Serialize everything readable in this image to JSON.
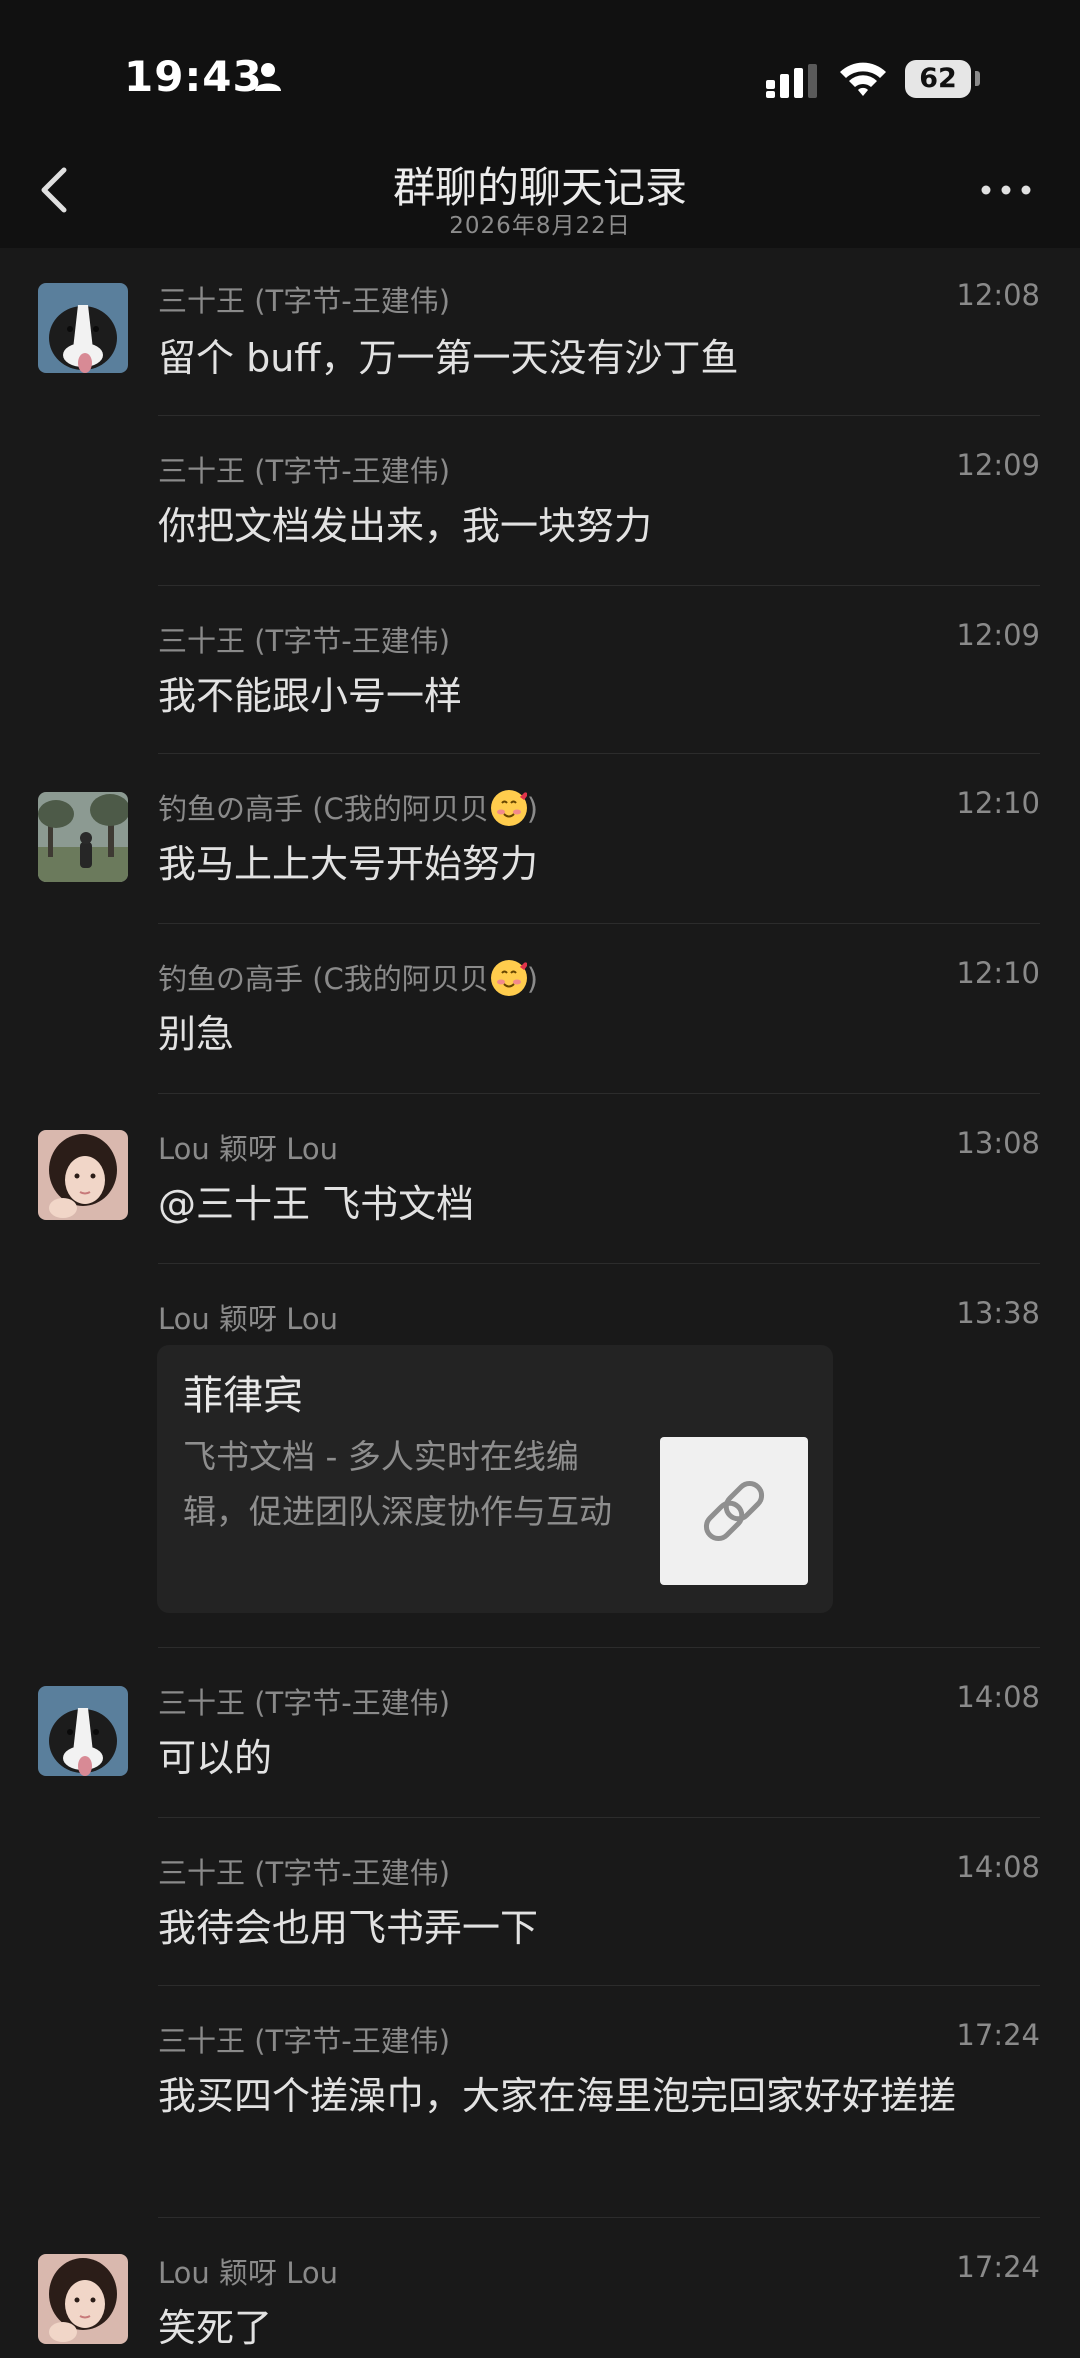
{
  "status_bar": {
    "time": "19:43",
    "battery": "62"
  },
  "nav": {
    "title": "群聊的聊天记录",
    "subtitle": "2026年8月22日"
  },
  "messages": [
    {
      "sender": "三十王 (T字节-王建伟)",
      "time": "12:08",
      "text": "留个 buff，万一第一天没有沙丁鱼"
    },
    {
      "sender": "三十王 (T字节-王建伟)",
      "time": "12:09",
      "text": "你把文档发出来，我一块努力"
    },
    {
      "sender": "三十王 (T字节-王建伟)",
      "time": "12:09",
      "text": "我不能跟小号一样"
    },
    {
      "sender": "钓鱼の高手 (C我的阿贝贝",
      "sender_suffix": ")",
      "time": "12:10",
      "text": "我马上上大号开始努力"
    },
    {
      "sender": "钓鱼の高手 (C我的阿贝贝",
      "sender_suffix": ")",
      "time": "12:10",
      "text": "别急"
    },
    {
      "sender": "Lou 颖呀 Lou",
      "time": "13:08",
      "text": "@三十王 飞书文档"
    },
    {
      "sender": "Lou 颖呀 Lou",
      "time": "13:38",
      "card": {
        "title": "菲律宾",
        "description": "飞书文档 - 多人实时在线编辑，促进团队深度协作与互动"
      }
    },
    {
      "sender": "三十王 (T字节-王建伟)",
      "time": "14:08",
      "text": "可以的"
    },
    {
      "sender": "三十王 (T字节-王建伟)",
      "time": "14:08",
      "text": "我待会也用飞书弄一下"
    },
    {
      "sender": "三十王 (T字节-王建伟)",
      "time": "17:24",
      "text": "我买四个搓澡巾，大家在海里泡完回家好好搓搓"
    },
    {
      "sender": "Lou 颖呀 Lou",
      "time": "17:24",
      "text": "笑死了"
    }
  ]
}
